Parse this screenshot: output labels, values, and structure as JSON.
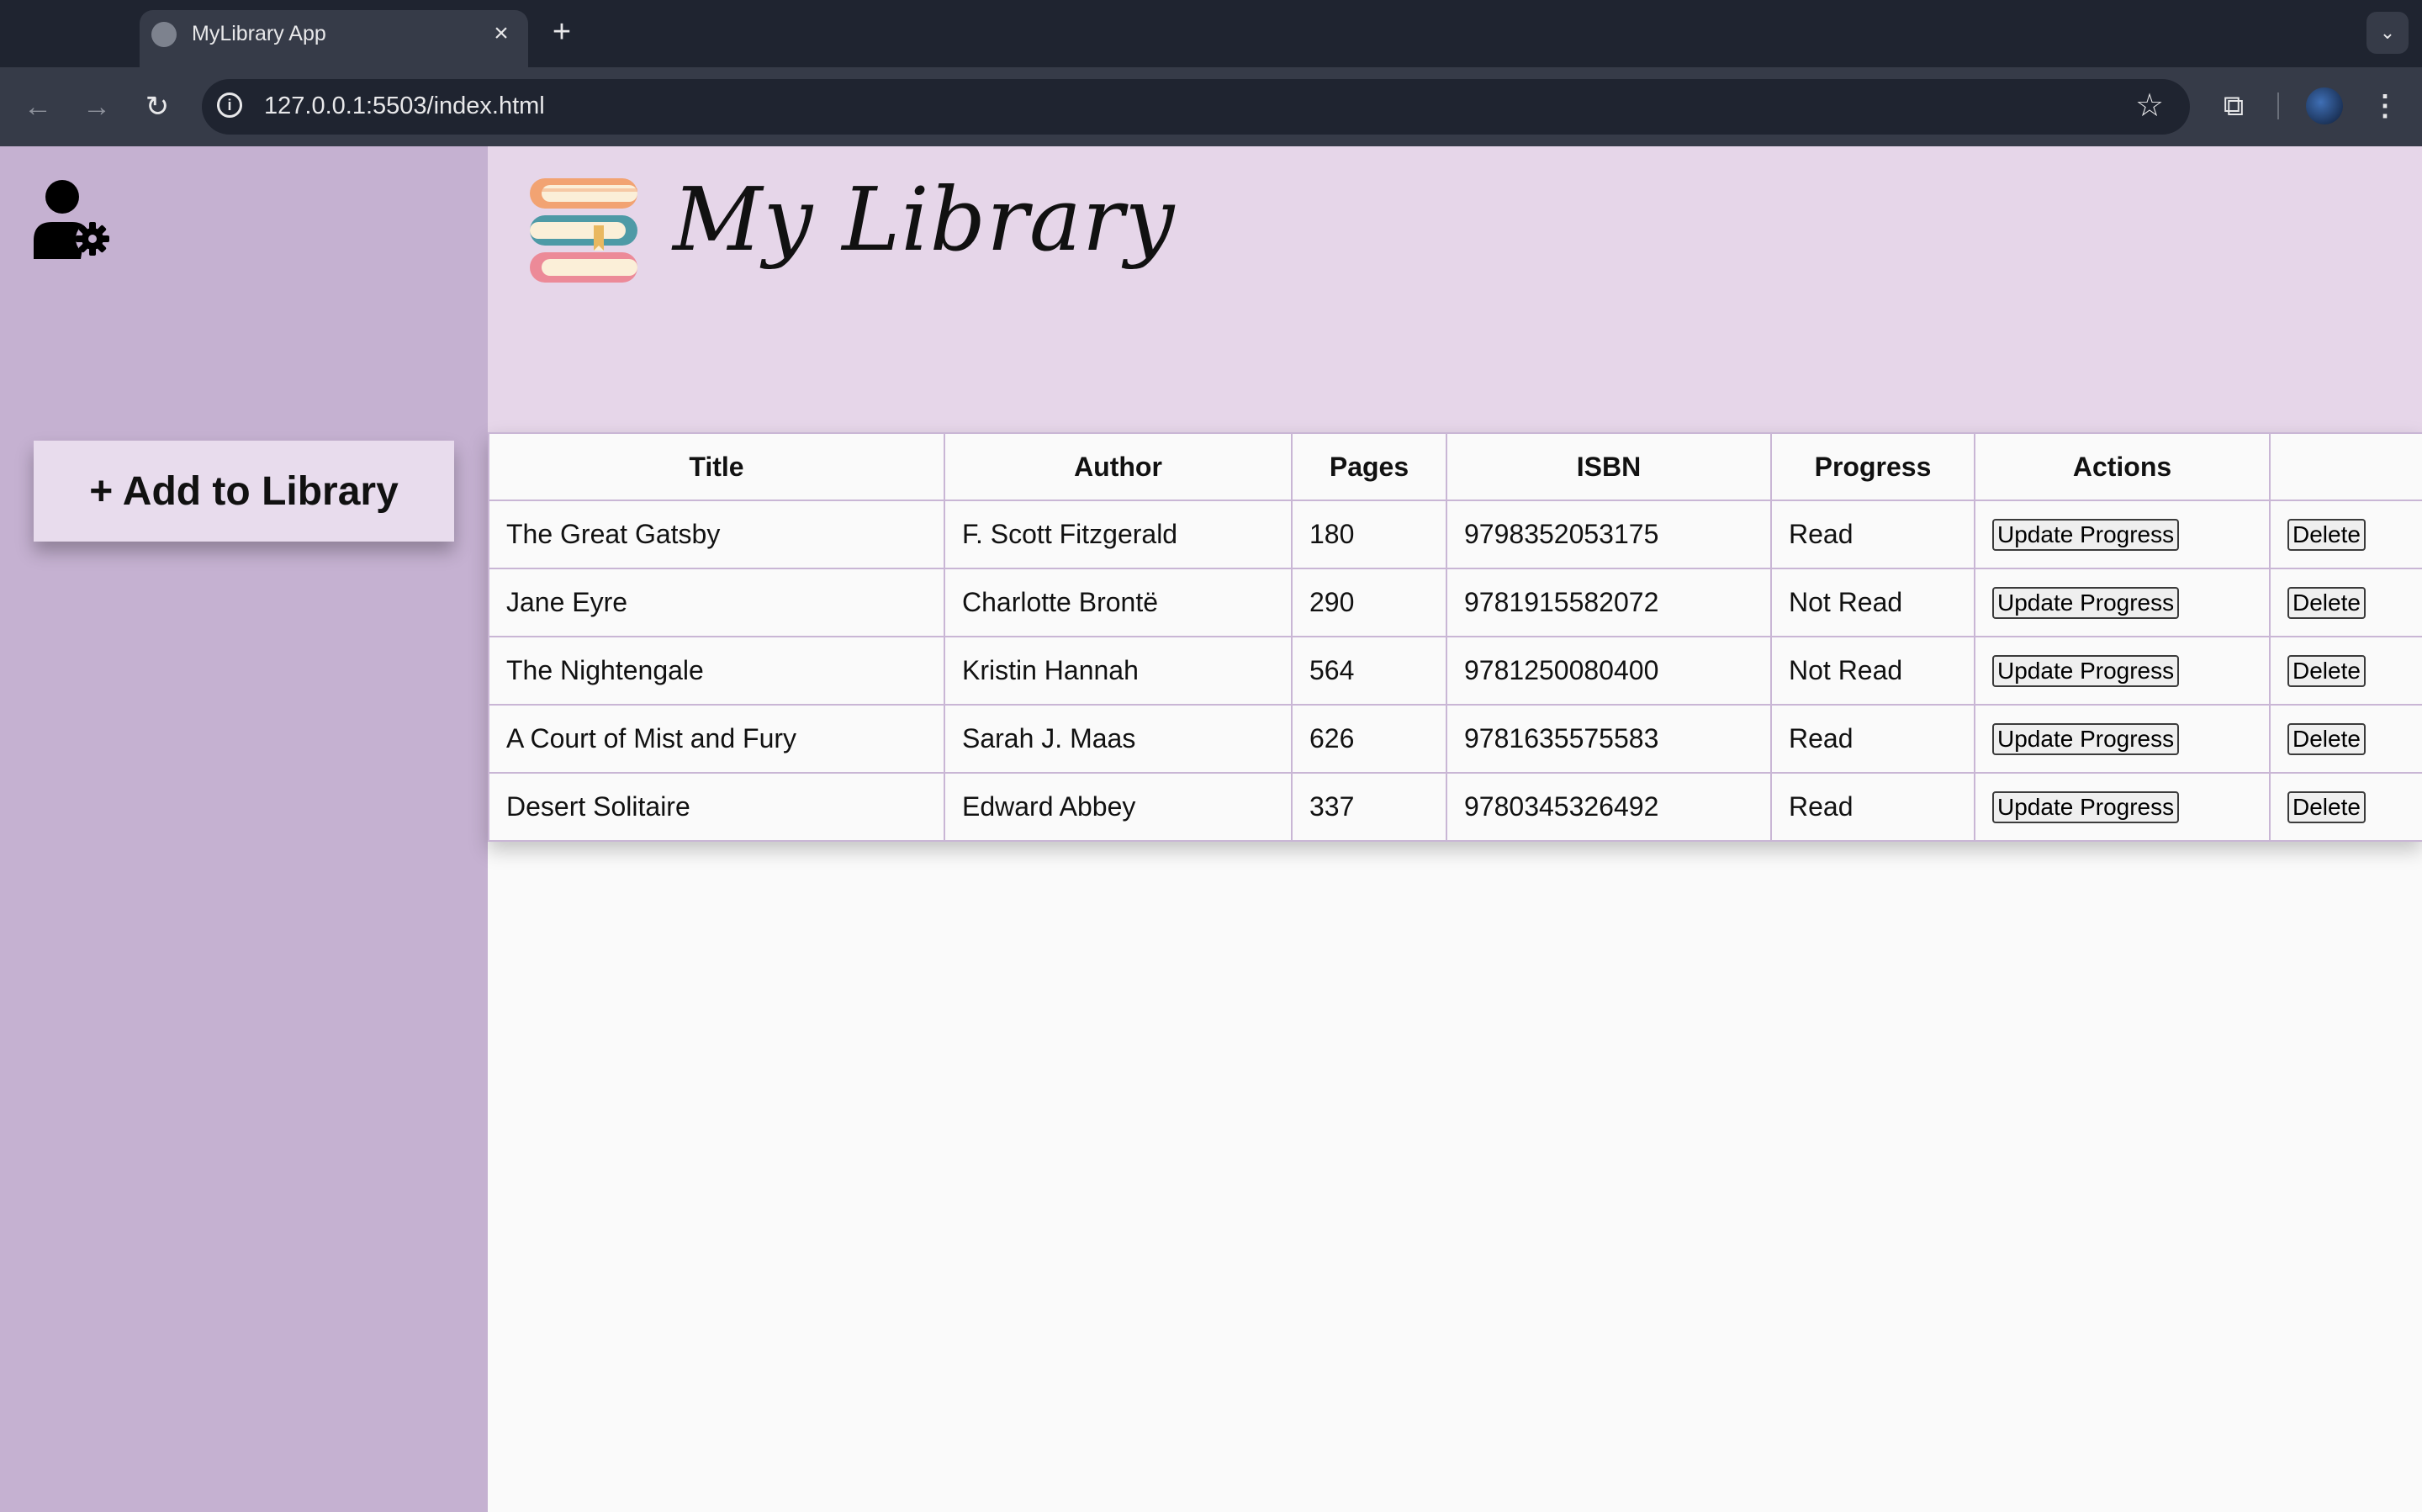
{
  "browser": {
    "tab_title": "MyLibrary App",
    "url": "127.0.0.1:5503/index.html"
  },
  "sidebar": {
    "add_button_label": "+ Add to Library"
  },
  "header": {
    "title": "My Library"
  },
  "table": {
    "headers": [
      "Title",
      "Author",
      "Pages",
      "ISBN",
      "Progress",
      "Actions",
      ""
    ],
    "update_label": "Update Progress",
    "delete_label": "Delete",
    "rows": [
      {
        "title": "The Great Gatsby",
        "author": "F. Scott Fitzgerald",
        "pages": "180",
        "isbn": "9798352053175",
        "progress": "Read"
      },
      {
        "title": "Jane Eyre",
        "author": "Charlotte Brontë",
        "pages": "290",
        "isbn": "9781915582072",
        "progress": "Not Read"
      },
      {
        "title": "The Nightengale",
        "author": "Kristin Hannah",
        "pages": "564",
        "isbn": "9781250080400",
        "progress": "Not Read"
      },
      {
        "title": "A Court of Mist and Fury",
        "author": "Sarah J. Maas",
        "pages": "626",
        "isbn": "9781635575583",
        "progress": "Read"
      },
      {
        "title": "Desert Solitaire",
        "author": "Edward Abbey",
        "pages": "337",
        "isbn": "9780345326492",
        "progress": "Read"
      }
    ]
  },
  "colors": {
    "sidebar_bg": "#c5b1d1",
    "header_bg": "#e6d6e9",
    "add_button_bg": "#e8dced",
    "table_border": "#c9b6d5",
    "browser_dark": "#1f2430",
    "browser_toolbar": "#363b48"
  },
  "icons": [
    "user-settings-icon",
    "books-logo-icon",
    "back-arrow-icon",
    "forward-arrow-icon",
    "reload-icon",
    "site-info-icon",
    "bookmark-star-icon",
    "extensions-icon",
    "profile-avatar",
    "menu-kebab-icon",
    "tab-close-icon",
    "new-tab-icon"
  ]
}
